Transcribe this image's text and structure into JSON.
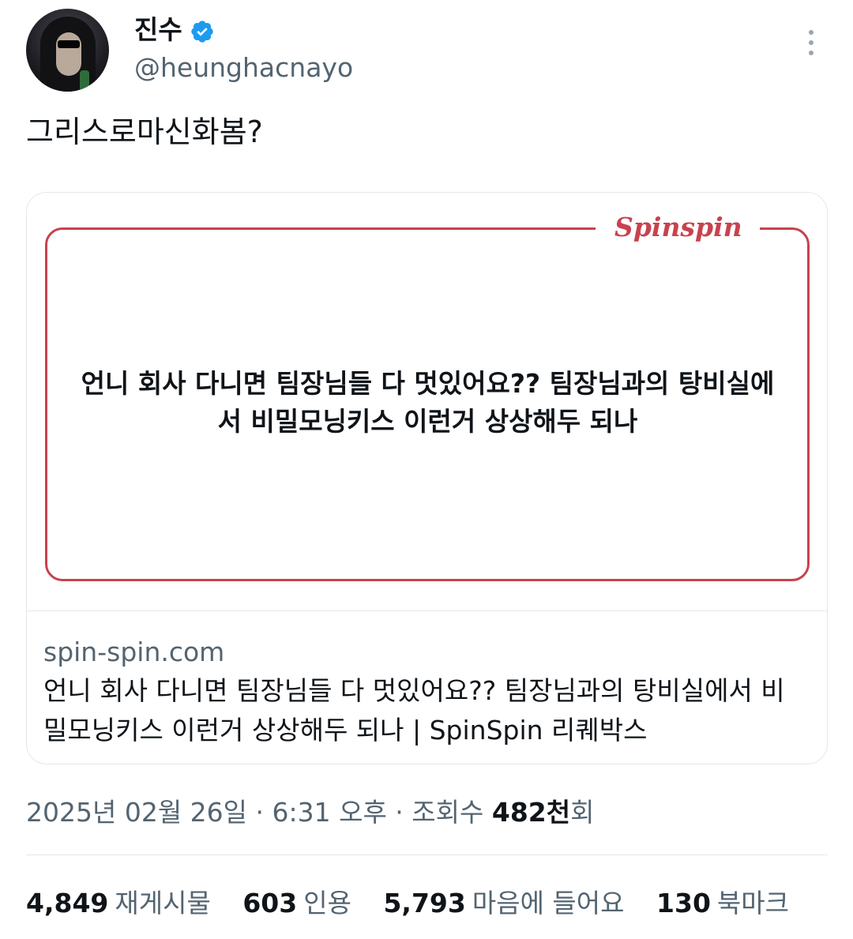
{
  "author": {
    "display_name": "진수",
    "handle": "@heunghacnayo",
    "verified": true,
    "avatar_icon": "user-avatar"
  },
  "tweet": {
    "text": "그리스로마신화봄?"
  },
  "card": {
    "brand": "Spinspin",
    "quote": "언니 회사 다니면 팀장님들 다 멋있어요?? 팀장님과의 탕비실에서 비밀모닝키스 이런거 상상해두 되나",
    "domain": "spin-spin.com",
    "title": "언니 회사 다니면 팀장님들 다 멋있어요?? 팀장님과의 탕비실에서 비밀모닝키스 이런거 상상해두 되나 | SpinSpin 리퀘박스",
    "accent_color": "#c8424e"
  },
  "meta": {
    "date_time": "2025년 02월 26일 · 6:31 오후 · 조회수",
    "views": "482천",
    "views_suffix": "회"
  },
  "stats": [
    {
      "num": "4,849",
      "label": "재게시물"
    },
    {
      "num": "603",
      "label": "인용"
    },
    {
      "num": "5,793",
      "label": "마음에 들어요"
    },
    {
      "num": "130",
      "label": "북마크"
    }
  ],
  "colors": {
    "text": "#0f1419",
    "secondary": "#536471",
    "verified": "#1d9bf0"
  }
}
